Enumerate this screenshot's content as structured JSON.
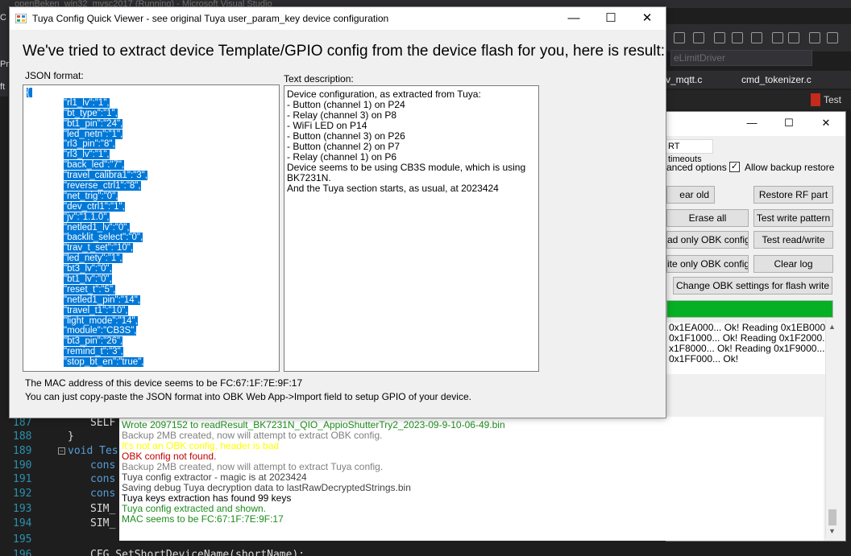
{
  "vs": {
    "title": "openBeken_win32_mvsc2017 (Running) - Microsoft Visual Studio",
    "dropdown": "eLimitDriver",
    "tabs": [
      "v_mqtt.c",
      "cmd_tokenizer.c"
    ],
    "test_label": "Test",
    "left_labels": [
      "C",
      "Pr",
      "ft"
    ]
  },
  "code": {
    "lines": [
      {
        "ln": "187",
        "text": "SELF"
      },
      {
        "ln": "188",
        "text": "}"
      },
      {
        "ln": "189",
        "text": "void Tes"
      },
      {
        "ln": "190",
        "text": "cons"
      },
      {
        "ln": "191",
        "text": "cons"
      },
      {
        "ln": "192",
        "text": "cons"
      },
      {
        "ln": "193",
        "text": "SIM_"
      },
      {
        "ln": "194",
        "text": "SIM_"
      },
      {
        "ln": "195",
        "text": ""
      },
      {
        "ln": "196",
        "text": "CFG_SetShortDeviceName(shortName);"
      }
    ]
  },
  "bg_window": {
    "tab_label": "RT timeouts",
    "advanced_options_label": "anced options",
    "allow_backup_restore_label": "Allow backup restore",
    "allow_backup_restore_checked": "✓",
    "buttons": {
      "clear_old": "ear old",
      "restore_rf": "Restore RF part",
      "erase_all": "Erase all",
      "test_write": "Test write pattern",
      "read_obk": "ad only OBK config",
      "test_read_write": "Test read/write",
      "write_obk": "ite only OBK config",
      "clear_log": "Clear log",
      "change_obk": "Change OBK settings for flash write"
    },
    "progress": 1.0,
    "progress_color": "#06b025",
    "log_top": [
      "0x1EA000... Ok! Reading 0x1EB000...",
      "0x1F1000... Ok! Reading 0x1F2000...",
      "x1F8000... Ok! Reading 0x1F9000...",
      "0x1FF000... Ok!"
    ]
  },
  "log": [
    {
      "text": "Wrote 2097152 to readResult_BK7231N_QIO_AppioShutterTry2_2023-09-9-10-06-49.bin",
      "color": "#1e8c1e"
    },
    {
      "text": "Backup 2MB created, now will attempt to extract OBK config.",
      "color": "#808080"
    },
    {
      "text": "It's not an OBK config, header is bad",
      "color": "#ffff00"
    },
    {
      "text": "OBK config not found.",
      "color": "#c00000"
    },
    {
      "text": "Backup 2MB created, now will attempt to extract Tuya config.",
      "color": "#808080"
    },
    {
      "text": "Tuya config extractor - magic is at 2023424",
      "color": "#404040"
    },
    {
      "text": "Saving debug Tuya decryption data to lastRawDecryptedStrings.bin",
      "color": "#404040"
    },
    {
      "text": "Tuya keys extraction has found 99 keys",
      "color": "#000000"
    },
    {
      "text": "Tuya config extracted and shown.",
      "color": "#1e8c1e"
    },
    {
      "text": "MAC seems to be FC:67:1F:7E:9F:17",
      "color": "#1e8c1e"
    }
  ],
  "dialog": {
    "title": "Tuya Config Quick Viewer - see original Tuya user_param_key device configuration",
    "heading": "We've tried to extract device Template/GPIO config from the device flash for you, here is result:",
    "json_label": "JSON format:",
    "text_label": "Text description:",
    "json_lines": [
      "{",
      "\"rl1_lv\":\"1\",",
      "\"bt_type\":\"1\",",
      "\"bt1_pin\":\"24\",",
      "\"led_netn\":\"1\",",
      "\"rl3_pin\":\"8\",",
      "\"rl3_lv\":\"1\",",
      "\"back_led\":\"7\",",
      "\"travel_calibra1\":\"3\",",
      "\"reverse_ctrl1\":\"8\",",
      "\"net_trig\":\"0\",",
      "\"dev_ctrl1\":\"1\",",
      "\"jv\":\"1.1.0\",",
      "\"netled1_lv\":\"0\",",
      "\"backlit_select\":\"0\",",
      "\"trav_t_set\":\"10\",",
      "\"led_nety\":\"1\",",
      "\"bt3_lv\":\"0\",",
      "\"bt1_lv\":\"0\",",
      "\"reset_t\":\"5\",",
      "\"netled1_pin\":\"14\",",
      "\"travel_t1\":\"10\",",
      "\"light_mode\":\"14\",",
      "\"module\":\"CB3S\",",
      "\"bt3_pin\":\"26\",",
      "\"remind_t\":\"3\",",
      "\"stop_bt_en\":\"true\","
    ],
    "text_lines": [
      "Device configuration, as extracted from Tuya:",
      "- Button (channel 1) on P24",
      "- Relay (channel 3) on P8",
      "- WiFi LED on P14",
      "- Button (channel 3) on P26",
      "- Button (channel 2) on P7",
      "- Relay (channel 1) on P6",
      "Device seems to be using CB3S module, which is using",
      "BK7231N.",
      "And the Tuya section starts, as usual, at 2023424"
    ],
    "mac_text": "The MAC address of this device seems to be FC:67:1F:7E:9F:17",
    "hint_text": "You can just copy-paste the JSON format into OBK Web App->Import field to setup GPIO of your device."
  }
}
